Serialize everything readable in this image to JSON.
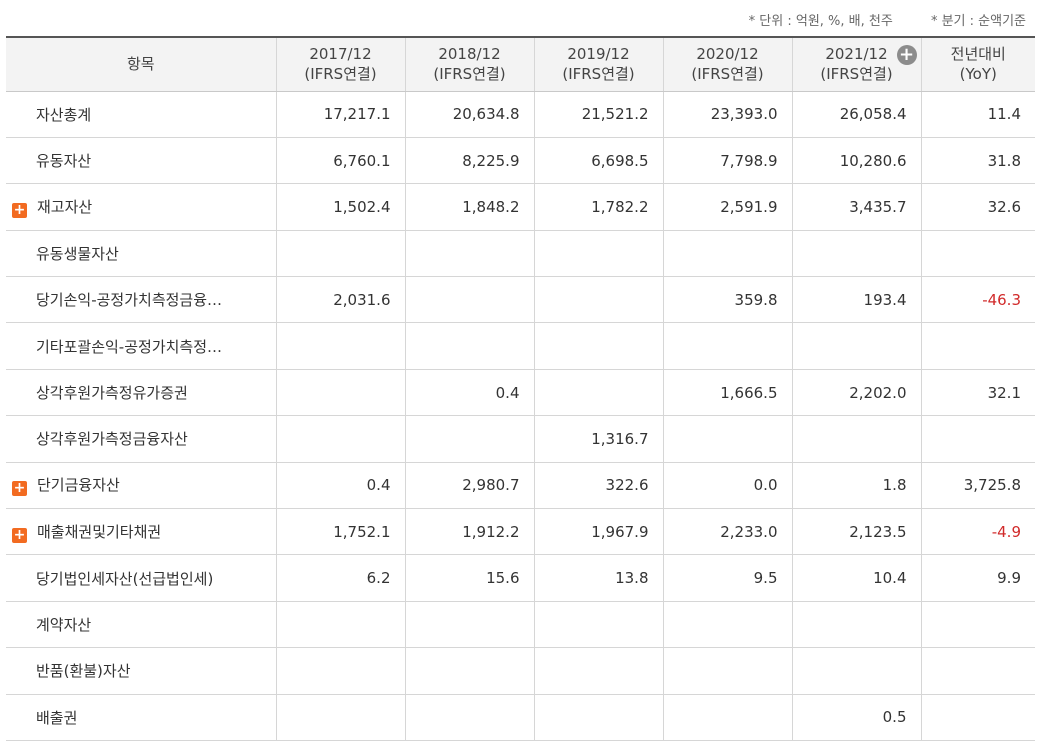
{
  "units": {
    "unit_note": "* 단위 : 억원, %, 배, 천주",
    "basis_note": "* 분기 : 순액기준"
  },
  "header": {
    "item_label": "항목",
    "periods": [
      {
        "year": "2017/12",
        "basis": "(IFRS연결)"
      },
      {
        "year": "2018/12",
        "basis": "(IFRS연결)"
      },
      {
        "year": "2019/12",
        "basis": "(IFRS연결)"
      },
      {
        "year": "2020/12",
        "basis": "(IFRS연결)"
      },
      {
        "year": "2021/12",
        "basis": "(IFRS연결)"
      }
    ],
    "yoy_line1": "전년대비",
    "yoy_line2": "(YoY)"
  },
  "rows": [
    {
      "label": "자산총계",
      "expandable": false,
      "values": [
        "17,217.1",
        "20,634.8",
        "21,521.2",
        "23,393.0",
        "26,058.4",
        "11.4"
      ]
    },
    {
      "label": "유동자산",
      "expandable": false,
      "values": [
        "6,760.1",
        "8,225.9",
        "6,698.5",
        "7,798.9",
        "10,280.6",
        "31.8"
      ]
    },
    {
      "label": "재고자산",
      "expandable": true,
      "values": [
        "1,502.4",
        "1,848.2",
        "1,782.2",
        "2,591.9",
        "3,435.7",
        "32.6"
      ]
    },
    {
      "label": "유동생물자산",
      "expandable": false,
      "values": [
        "",
        "",
        "",
        "",
        "",
        ""
      ]
    },
    {
      "label": "당기손익-공정가치측정금융…",
      "expandable": false,
      "values": [
        "2,031.6",
        "",
        "",
        "359.8",
        "193.4",
        "-46.3"
      ]
    },
    {
      "label": "기타포괄손익-공정가치측정…",
      "expandable": false,
      "values": [
        "",
        "",
        "",
        "",
        "",
        ""
      ]
    },
    {
      "label": "상각후원가측정유가증권",
      "expandable": false,
      "values": [
        "",
        "0.4",
        "",
        "1,666.5",
        "2,202.0",
        "32.1"
      ]
    },
    {
      "label": "상각후원가측정금융자산",
      "expandable": false,
      "values": [
        "",
        "",
        "1,316.7",
        "",
        "",
        ""
      ]
    },
    {
      "label": "단기금융자산",
      "expandable": true,
      "values": [
        "0.4",
        "2,980.7",
        "322.6",
        "0.0",
        "1.8",
        "3,725.8"
      ]
    },
    {
      "label": "매출채권및기타채권",
      "expandable": true,
      "values": [
        "1,752.1",
        "1,912.2",
        "1,967.9",
        "2,233.0",
        "2,123.5",
        "-4.9"
      ]
    },
    {
      "label": "당기법인세자산(선급법인세)",
      "expandable": false,
      "values": [
        "6.2",
        "15.6",
        "13.8",
        "9.5",
        "10.4",
        "9.9"
      ]
    },
    {
      "label": "계약자산",
      "expandable": false,
      "values": [
        "",
        "",
        "",
        "",
        "",
        ""
      ]
    },
    {
      "label": "반품(환불)자산",
      "expandable": false,
      "values": [
        "",
        "",
        "",
        "",
        "",
        ""
      ]
    },
    {
      "label": "배출권",
      "expandable": false,
      "values": [
        "",
        "",
        "",
        "",
        "0.5",
        ""
      ]
    }
  ],
  "colors": {
    "negative": "#d12a2a",
    "toggle": "#f26b21",
    "header_bg": "#f3f3f3"
  },
  "icons": {
    "expand": "plus-square-icon",
    "add_column": "plus-circle-icon"
  }
}
